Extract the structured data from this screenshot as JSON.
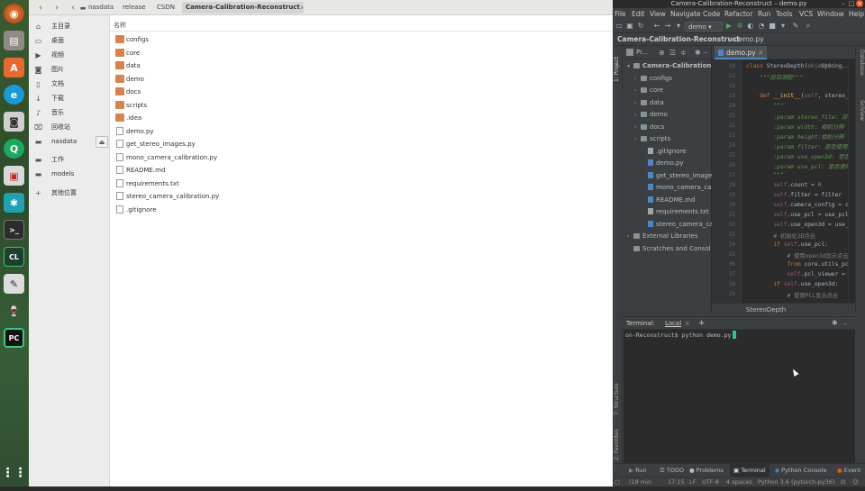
{
  "dock": {
    "icons": [
      "firefox-icon",
      "files-icon",
      "software-center-icon",
      "browser-e-icon",
      "camera-icon",
      "search-q-icon",
      "screenshot-icon",
      "network-icon",
      "terminal-icon",
      "clion-icon",
      "inkscape-icon",
      "wine-icon",
      "pycharm-icon",
      "app-grid-icon"
    ]
  },
  "nautilus": {
    "breadcrumb": [
      "nasdata",
      "release",
      "CSDN",
      "Camera-Calibration-Reconstruct"
    ],
    "places": [
      {
        "label": "主目录",
        "icon": "home-icon"
      },
      {
        "label": "桌面",
        "icon": "desktop-icon"
      },
      {
        "label": "视频",
        "icon": "video-icon"
      },
      {
        "label": "图片",
        "icon": "pictures-icon"
      },
      {
        "label": "文档",
        "icon": "documents-icon"
      },
      {
        "label": "下载",
        "icon": "download-icon"
      },
      {
        "label": "音乐",
        "icon": "music-icon"
      },
      {
        "label": "回收站",
        "icon": "trash-icon"
      },
      {
        "label": "nasdata",
        "icon": "drive-icon"
      },
      {
        "label": "工作",
        "icon": "folder-icon"
      },
      {
        "label": "models",
        "icon": "folder-icon"
      },
      {
        "label": "其他位置",
        "icon": "plus-icon"
      }
    ],
    "column_header": "名称",
    "files": [
      {
        "name": "configs",
        "type": "folder"
      },
      {
        "name": "core",
        "type": "folder"
      },
      {
        "name": "data",
        "type": "folder"
      },
      {
        "name": "demo",
        "type": "folder"
      },
      {
        "name": "docs",
        "type": "folder"
      },
      {
        "name": "scripts",
        "type": "folder"
      },
      {
        "name": ".idea",
        "type": "folder"
      },
      {
        "name": "demo.py",
        "type": "file"
      },
      {
        "name": "get_stereo_images.py",
        "type": "file"
      },
      {
        "name": "mono_camera_calibration.py",
        "type": "file"
      },
      {
        "name": "README.md",
        "type": "file"
      },
      {
        "name": "requirements.txt",
        "type": "file"
      },
      {
        "name": "stereo_camera_calibration.py",
        "type": "file"
      },
      {
        "name": ".gitignore",
        "type": "file"
      }
    ]
  },
  "pycharm": {
    "title": "Camera-Calibration-Reconstruct – demo.py",
    "menu": [
      "File",
      "Edit",
      "View",
      "Navigate",
      "Code",
      "Refactor",
      "Run",
      "Tools",
      "VCS",
      "Window",
      "Help"
    ],
    "run_config": "demo",
    "nav_project": "Camera-Calibration-Reconstruct",
    "nav_file": "demo.py",
    "project_tab": "Pr...",
    "side_tabs": {
      "project": "1: Project",
      "structure": "7: Structure",
      "favorites": "2: Favorites",
      "database": "Database",
      "sciview": "SciView"
    },
    "editor_tab": "demo.py",
    "syncing": "Syncing...",
    "tree": [
      {
        "label": "Camera-Calibration",
        "kind": "root",
        "indent": 0,
        "arrow": "▾"
      },
      {
        "label": "configs",
        "kind": "folder",
        "indent": 1,
        "arrow": "›"
      },
      {
        "label": "core",
        "kind": "folder",
        "indent": 1,
        "arrow": "›"
      },
      {
        "label": "data",
        "kind": "folder",
        "indent": 1,
        "arrow": "›"
      },
      {
        "label": "demo",
        "kind": "folder",
        "indent": 1,
        "arrow": "›"
      },
      {
        "label": "docs",
        "kind": "folder",
        "indent": 1,
        "arrow": "›"
      },
      {
        "label": "scripts",
        "kind": "folder",
        "indent": 1,
        "arrow": "›"
      },
      {
        "label": ".gitignore",
        "kind": "file",
        "indent": 2,
        "arrow": ""
      },
      {
        "label": "demo.py",
        "kind": "py",
        "indent": 2,
        "arrow": ""
      },
      {
        "label": "get_stereo_images",
        "kind": "py",
        "indent": 2,
        "arrow": ""
      },
      {
        "label": "mono_camera_cal",
        "kind": "py",
        "indent": 2,
        "arrow": ""
      },
      {
        "label": "README.md",
        "kind": "py",
        "indent": 2,
        "arrow": ""
      },
      {
        "label": "requirements.txt",
        "kind": "file",
        "indent": 2,
        "arrow": ""
      },
      {
        "label": "stereo_camera_ca",
        "kind": "py",
        "indent": 2,
        "arrow": ""
      },
      {
        "label": "External Libraries",
        "kind": "lib",
        "indent": 0,
        "arrow": "›"
      },
      {
        "label": "Scratches and Consol",
        "kind": "lib",
        "indent": 0,
        "arrow": ""
      }
    ],
    "code_lines": [
      {
        "n": "16",
        "html": "<span class='kw'>class</span> StereoDepth(<span class='gcm'>object</span>):"
      },
      {
        "n": "17",
        "html": "    <span class='cm'>\"\"\"双目测距\"\"\"</span>"
      },
      {
        "n": "18",
        "html": ""
      },
      {
        "n": "19",
        "html": "    <span class='kw'>def</span> <span class='fnm'>__init__</span>(<span class='sf'>self</span>, stereo_"
      },
      {
        "n": "20",
        "html": "        <span class='cm'>\"\"\"</span>"
      },
      {
        "n": "21",
        "html": "        <span class='cm'>:param stereo_file: 双</span>"
      },
      {
        "n": "22",
        "html": "        <span class='cm'>:param width: 相机分辨</span>"
      },
      {
        "n": "23",
        "html": "        <span class='cm'>:param height:相机分辨</span>"
      },
      {
        "n": "24",
        "html": "        <span class='cm'>:param filter: 是否使用</span>"
      },
      {
        "n": "25",
        "html": "        <span class='cm'>:param use_open3d: 是否</span>"
      },
      {
        "n": "26",
        "html": "        <span class='cm'>:param use_pcl: 是否使用</span>"
      },
      {
        "n": "27",
        "html": "        <span class='cm'>\"\"\"</span>"
      },
      {
        "n": "28",
        "html": "        <span class='sf'>self</span>.count = <span class='num'>0</span>"
      },
      {
        "n": "29",
        "html": "        <span class='sf'>self</span>.filter = filter"
      },
      {
        "n": "30",
        "html": "        <span class='sf'>self</span>.camera_config = c"
      },
      {
        "n": "31",
        "html": "        <span class='sf'>self</span>.use_pcl = use_pcl"
      },
      {
        "n": "32",
        "html": "        <span class='sf'>self</span>.use_open3d = use_"
      },
      {
        "n": "33",
        "html": "        <span class='gcm'># 初始化3D点云</span>"
      },
      {
        "n": "34",
        "html": "        <span class='kw'>if</span> <span class='sf'>self</span>.use_pcl:"
      },
      {
        "n": "35",
        "html": "            <span class='gcm'># 使用open3d显示点云</span>"
      },
      {
        "n": "36",
        "html": "            <span class='kw'>from</span> core.utils_pc"
      },
      {
        "n": "37",
        "html": "            <span class='sf'>self</span>.pcl_viewer = "
      },
      {
        "n": "38",
        "html": "        <span class='kw'>if</span> <span class='sf'>self</span>.use_open3d:"
      },
      {
        "n": "39",
        "html": "            <span class='gcm'># 使用PCL显示点云</span>"
      }
    ],
    "structure_crumb": "StereoDepth",
    "terminal": {
      "label": "Terminal:",
      "tab": "Local",
      "prompt": "on-Reconstruct$ python demo.py"
    },
    "bottom_tabs": [
      {
        "label": "Run",
        "icon": "run-icon"
      },
      {
        "label": "TODO",
        "icon": "todo-icon"
      },
      {
        "label": "Problems",
        "icon": "problems-icon"
      },
      {
        "label": "Terminal",
        "icon": "terminal-icon"
      },
      {
        "label": "Python Console",
        "icon": "python-console-icon"
      },
      {
        "label": "Event Lo",
        "icon": "event-log-icon"
      }
    ],
    "status": {
      "time_ago": "(18 min",
      "position": "17:15",
      "line_sep": "LF",
      "encoding": "UTF-8",
      "indent": "4 spaces",
      "interpreter": "Python 3.6 (pytorch-py36)"
    }
  },
  "colors": {
    "accent_orange": "#e95420",
    "folder": "#d9824a",
    "pycharm_bg": "#2b2b2b",
    "terminal_caret": "#20c997"
  }
}
